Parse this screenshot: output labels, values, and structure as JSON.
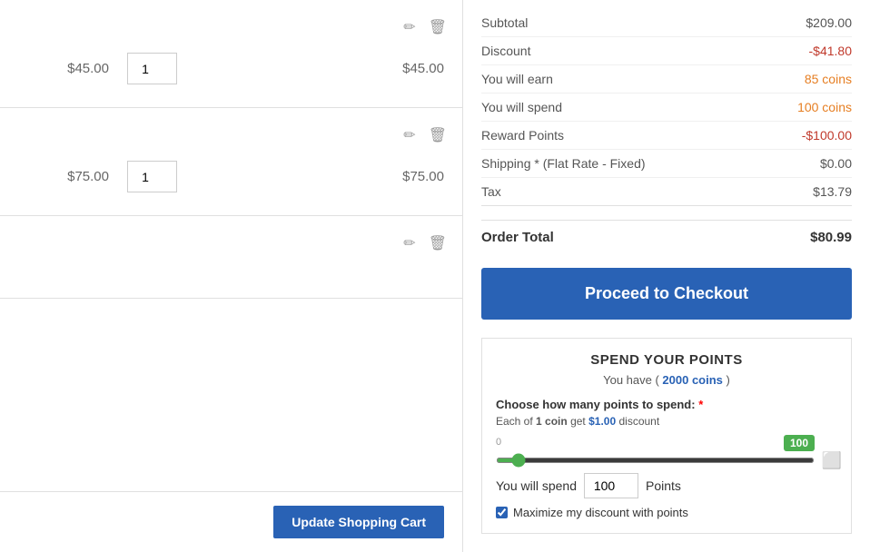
{
  "cart": {
    "items": [
      {
        "id": "item-1",
        "price": "$45.00",
        "qty": "1",
        "total": "$45.00"
      },
      {
        "id": "item-2",
        "price": "$75.00",
        "qty": "1",
        "total": "$75.00"
      },
      {
        "id": "item-3",
        "price": "",
        "qty": "",
        "total": ""
      }
    ],
    "update_btn": "Update Shopping Cart"
  },
  "summary": {
    "subtotal_label": "Subtotal",
    "subtotal_value": "$209.00",
    "discount_label": "Discount",
    "discount_value": "-$41.80",
    "earn_label": "You will earn",
    "earn_value": "85 coins",
    "spend_label": "You will spend",
    "spend_value": "100 coins",
    "reward_label": "Reward Points",
    "reward_value": "-$100.00",
    "shipping_label": "Shipping * (Flat Rate - Fixed)",
    "shipping_value": "$0.00",
    "tax_label": "Tax",
    "tax_value": "$13.79",
    "order_total_label": "Order Total",
    "order_total_value": "$80.99",
    "checkout_btn": "Proceed to Checkout"
  },
  "spend_points": {
    "title": "SPEND YOUR POINTS",
    "coins_info_pre": "You have (",
    "coins_count": "2000 coins",
    "coins_info_post": ")",
    "choose_label": "Choose how many points to spend:",
    "required_star": "*",
    "rate_pre": "Each of",
    "rate_coin": "1 coin",
    "rate_mid": "get",
    "rate_amount": "$1.00",
    "rate_post": "discount",
    "slider_min": "0",
    "slider_max": "100",
    "slider_value": 100,
    "you_will_spend_label": "You will spend",
    "you_will_spend_value": "100",
    "points_label": "Points",
    "maximize_label": "Maximize my discount with points",
    "maximize_checked": true
  }
}
